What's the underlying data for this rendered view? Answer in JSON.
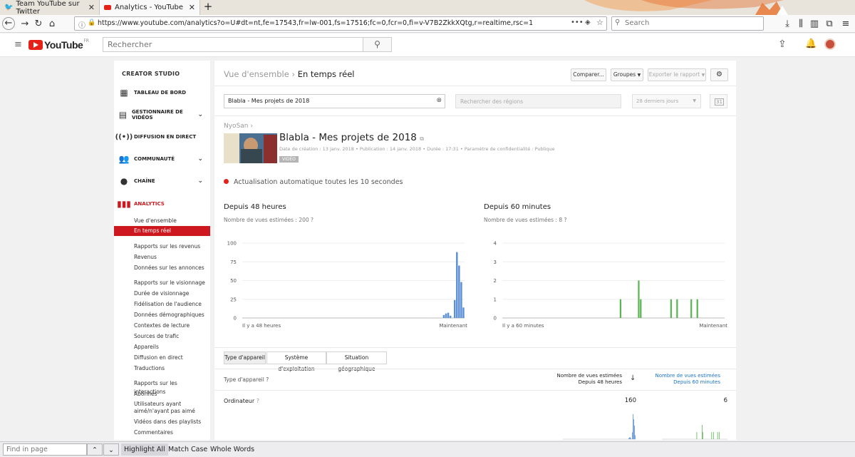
{
  "browser": {
    "tabs": [
      {
        "title": "Team YouTube sur Twitter",
        "close": "✕"
      },
      {
        "title": "Analytics - YouTube",
        "close": "✕"
      }
    ],
    "new_tab": "+",
    "url": "https://www.youtube.com/analytics?o=U#dt=nt,fe=17543,fr=lw-001,fs=17516;fc=0,fcr=0,fi=v-V7B2ZkkXQtg,r=realtime,rsc=1",
    "url_more": "•••",
    "search_placeholder": "Search"
  },
  "youtube": {
    "logo_text": "YouTube",
    "logo_region": "FR",
    "search_placeholder": "Rechercher"
  },
  "sidebar": {
    "title": "CREATOR STUDIO",
    "items": [
      {
        "label": "TABLEAU DE BORD",
        "icon": "dashboard-icon"
      },
      {
        "label": "GESTIONNAIRE DE VIDÉOS",
        "icon": "video-manager-icon"
      },
      {
        "label": "DIFFUSION EN DIRECT",
        "icon": "live-icon"
      },
      {
        "label": "COMMUNAUTÉ",
        "icon": "community-icon"
      },
      {
        "label": "CHAÎNE",
        "icon": "channel-icon"
      },
      {
        "label": "ANALYTICS",
        "icon": "analytics-icon"
      }
    ],
    "analytics_sub": [
      "Vue d'ensemble",
      "En temps réel"
    ],
    "group_revenue": "Rapports sur les revenus",
    "revenue_items": [
      "Revenus",
      "Données sur les annonces"
    ],
    "group_viewing": "Rapports sur le visionnage",
    "viewing_items": [
      "Durée de visionnage",
      "Fidélisation de l'audience",
      "Données démographiques",
      "Contextes de lecture",
      "Sources de trafic",
      "Appareils",
      "Diffusion en direct",
      "Traductions"
    ],
    "group_interactions": "Rapports sur les interactions",
    "interaction_items": [
      "Abonnés",
      "Utilisateurs ayant aimé/n'ayant pas aimé",
      "Vidéos dans des playlists",
      "Commentaires"
    ]
  },
  "main": {
    "breadcrumb_parent": "Vue d'ensemble",
    "breadcrumb_sep": "›",
    "breadcrumb_current": "En temps réel",
    "compare_button": "Comparer...",
    "groups_button": "Groupes",
    "export_button": "Exporter le rapport",
    "filter_value": "Blabla - Mes projets de 2018",
    "region_placeholder": "Rechercher des régions",
    "period_value": "28 derniers jours",
    "calendar_label": "31",
    "channel_name": "NyoSan",
    "video_title": "Blabla - Mes projets de 2018",
    "meta_creation": "Date de création : 13 janv. 2018",
    "meta_publication": "Publication : 14 janv. 2018",
    "meta_duration": "Durée : 17:31",
    "meta_privacy": "Paramètre de confidentialité : Publique",
    "badge": "VIDÉO",
    "auto_refresh": "Actualisation automatique toutes les 10 secondes",
    "panel48_title": "Depuis 48 heures",
    "panel48_views": "Nombre de vues estimées : 200",
    "panel60_title": "Depuis 60 minutes",
    "panel60_views": "Nombre de vues estimées : 8",
    "subtabs": [
      "Type d'appareil",
      "Système d'exploitation",
      "Situation géographique"
    ],
    "table_col_device": "Type d'appareil",
    "table_col_48_line1": "Nombre de vues estimées",
    "table_col_48_line2": "Depuis 48 heures",
    "table_col_60_line1": "Nombre de vues estimées",
    "table_col_60_line2": "Depuis 60 minutes",
    "row_label": "Ordinateur",
    "row_48_value": "160",
    "row_60_value": "6"
  },
  "chart_data": [
    {
      "type": "bar",
      "y_ticks": [
        "100",
        "75",
        "50",
        "25",
        "0"
      ],
      "ylim": [
        0,
        100
      ],
      "x_start_label": "Il y a 48 heures",
      "x_end_label": "Maintenant",
      "color": "#5b8fd6",
      "values": [
        0,
        0,
        0,
        0,
        0,
        0,
        0,
        0,
        0,
        0,
        0,
        0,
        0,
        0,
        0,
        0,
        0,
        0,
        0,
        0,
        0,
        0,
        0,
        0,
        0,
        0,
        0,
        0,
        0,
        0,
        0,
        0,
        0,
        0,
        0,
        0,
        0,
        0,
        0,
        0,
        0,
        0,
        0,
        0,
        0,
        0,
        0,
        0,
        0,
        0,
        0,
        0,
        0,
        0,
        0,
        0,
        0,
        0,
        0,
        0,
        0,
        0,
        0,
        0,
        0,
        0,
        0,
        0,
        0,
        0,
        0,
        0,
        0,
        0,
        0,
        0,
        0,
        0,
        0,
        0,
        0,
        0,
        0,
        0,
        0,
        0,
        0,
        0,
        0,
        0,
        0,
        0,
        4,
        6,
        7,
        3,
        0,
        24,
        88,
        70,
        48,
        14
      ]
    },
    {
      "type": "bar",
      "y_ticks": [
        "4",
        "3",
        "2",
        "1",
        "0"
      ],
      "ylim": [
        0,
        4
      ],
      "x_start_label": "Il y a 60 minutes",
      "x_end_label": "Maintenant",
      "color": "#5ab552",
      "values": [
        0,
        0,
        0,
        0,
        0,
        0,
        0,
        0,
        0,
        0,
        0,
        0,
        0,
        0,
        0,
        0,
        0,
        0,
        0,
        0,
        0,
        0,
        0,
        0,
        0,
        0,
        0,
        0,
        0,
        0,
        0,
        0,
        0,
        0,
        0,
        0,
        0,
        0,
        0,
        0,
        0,
        0,
        0,
        0,
        0,
        0,
        0,
        0,
        0,
        0,
        0,
        0,
        0,
        0,
        0,
        0,
        0,
        0,
        1,
        0,
        0,
        0,
        0,
        0,
        0,
        0,
        0,
        2,
        1,
        0,
        0,
        0,
        0,
        0,
        0,
        0,
        0,
        0,
        0,
        0,
        0,
        0,
        0,
        1,
        0,
        0,
        1,
        0,
        0,
        0,
        0,
        0,
        0,
        1,
        0,
        0,
        1,
        0,
        0,
        0,
        0,
        0,
        0,
        0,
        0,
        0,
        0,
        0,
        0,
        0
      ]
    }
  ],
  "findbar": {
    "placeholder": "Find in page",
    "up": "⌃",
    "down": "⌄",
    "highlight": "Highlight All",
    "match_case": "Match Case",
    "whole_words": "Whole Words"
  }
}
